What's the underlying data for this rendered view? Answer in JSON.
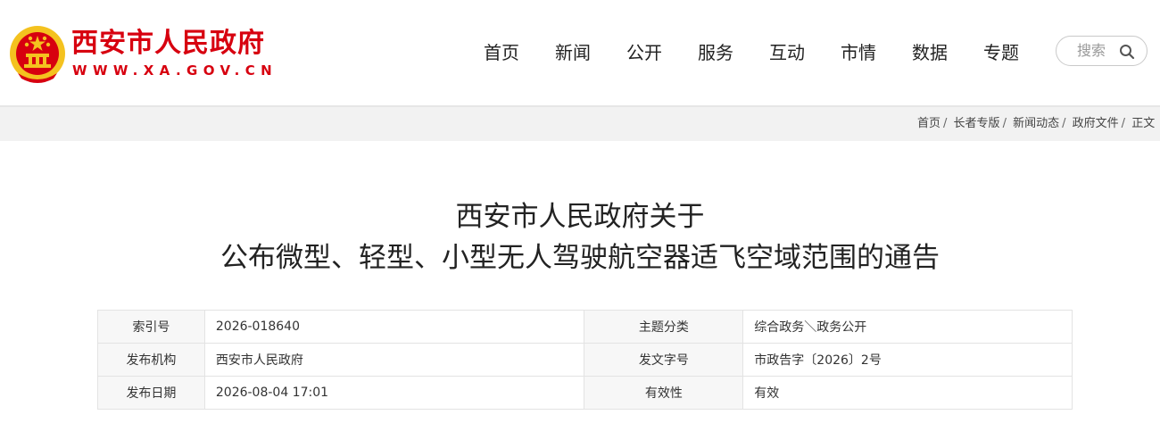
{
  "header": {
    "site_name": "西安市人民政府",
    "site_url": "WWW.XA.GOV.CN",
    "emblem_icon": "national-emblem-icon",
    "brand_color": "#d7000f"
  },
  "nav": {
    "items": [
      {
        "label": "首页"
      },
      {
        "label": "新闻"
      },
      {
        "label": "公开"
      },
      {
        "label": "服务"
      },
      {
        "label": "互动"
      },
      {
        "label": "市情"
      },
      {
        "label": "数据"
      },
      {
        "label": "专题"
      }
    ]
  },
  "search": {
    "label": "搜索",
    "icon": "search-icon"
  },
  "breadcrumb": {
    "items": [
      "首页",
      "长者专版",
      "新闻动态",
      "政府文件",
      "正文"
    ],
    "separator": "/"
  },
  "document": {
    "title_line1": "西安市人民政府关于",
    "title_line2": "公布微型、轻型、小型无人驾驶航空器适飞空域范围的通告",
    "meta": {
      "index_label": "索引号",
      "index_value": "2026-018640",
      "topic_label": "主题分类",
      "topic_value": "综合政务＼政务公开",
      "publisher_label": "发布机构",
      "publisher_value": "西安市人民政府",
      "doc_no_label": "发文字号",
      "doc_no_value": "市政告字〔2026〕2号",
      "date_label": "发布日期",
      "date_value": "2026-08-04 17:01",
      "validity_label": "有效性",
      "validity_value": "有效"
    }
  }
}
